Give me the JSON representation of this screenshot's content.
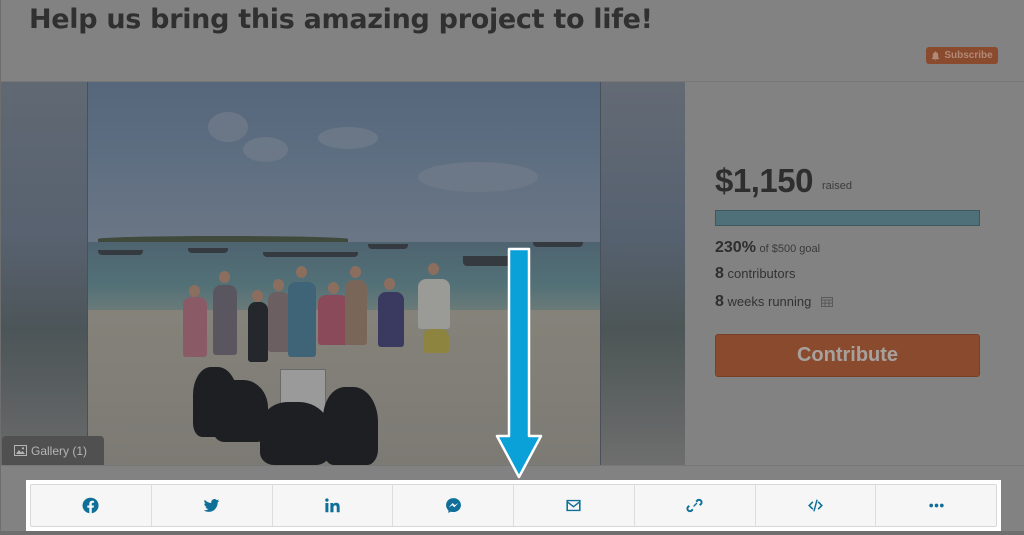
{
  "campaign": {
    "title": "Help us bring this amazing project to life!",
    "subscribe_label": "Subscribe",
    "gallery_label": "Gallery (1)"
  },
  "stats": {
    "amount_raised": "$1,150",
    "amount_suffix": "raised",
    "percent_funded": "230%",
    "goal_text": "of $500 goal",
    "progress_fraction": 1.0,
    "contributors_count": "8",
    "contributors_label": "contributors",
    "weeks_count": "8",
    "weeks_label": "weeks running"
  },
  "actions": {
    "contribute_label": "Contribute"
  },
  "share": {
    "buttons": [
      {
        "name": "facebook",
        "icon": "facebook-icon"
      },
      {
        "name": "twitter",
        "icon": "twitter-icon"
      },
      {
        "name": "linkedin",
        "icon": "linkedin-icon"
      },
      {
        "name": "messenger",
        "icon": "messenger-icon"
      },
      {
        "name": "email",
        "icon": "envelope-icon"
      },
      {
        "name": "copy-link",
        "icon": "link-icon"
      },
      {
        "name": "embed",
        "icon": "code-icon"
      },
      {
        "name": "more",
        "icon": "ellipsis-icon"
      }
    ]
  },
  "colors": {
    "accent_orange": "#e2713d",
    "progress_teal": "#4f6f79",
    "share_icon_blue": "#0f6f98",
    "annotation_arrow": "#0aa0d8"
  }
}
